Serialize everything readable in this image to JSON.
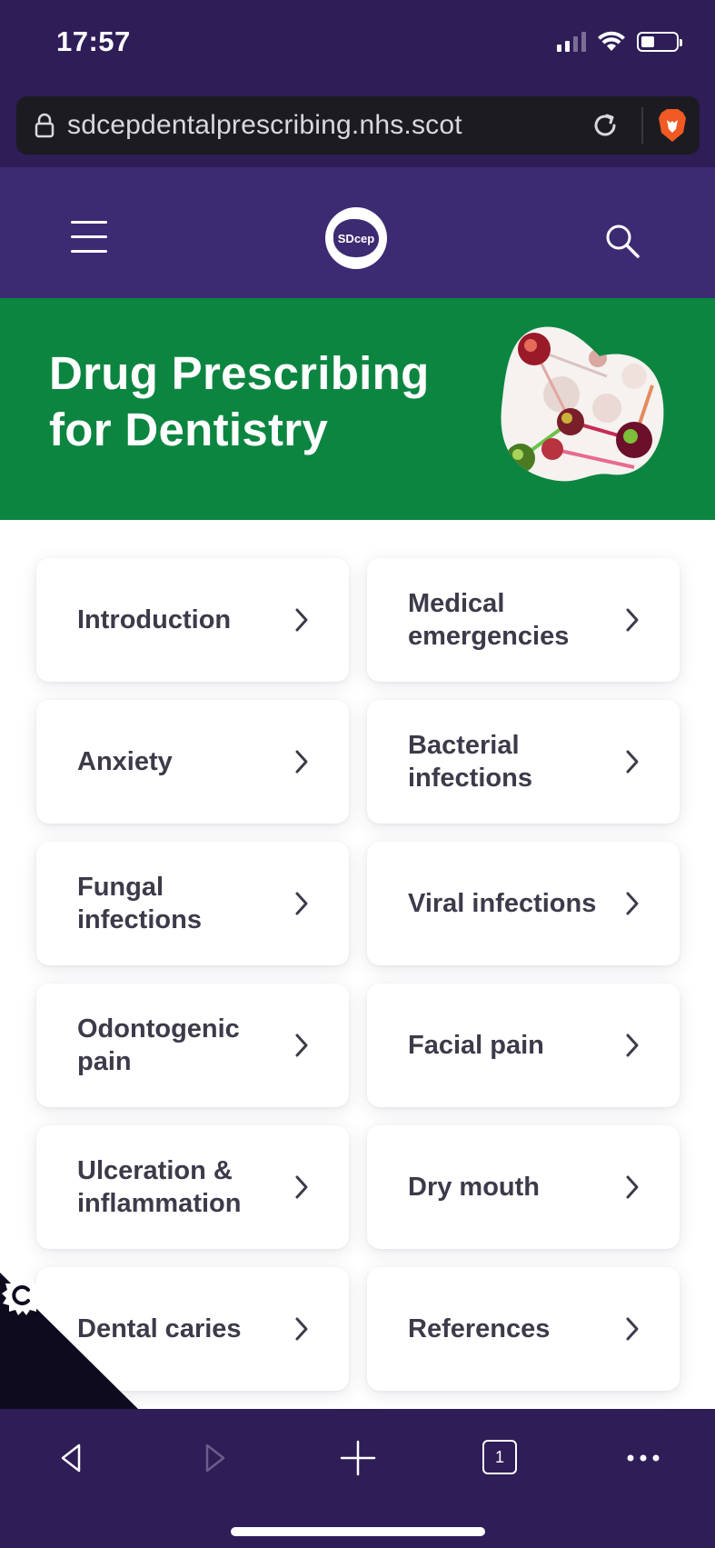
{
  "status_bar": {
    "time": "17:57"
  },
  "browser": {
    "url": "sdcepdentalprescribing.nhs.scot"
  },
  "site": {
    "logo_text": "SDcep"
  },
  "hero": {
    "title_line1": "Drug Prescribing",
    "title_line2": "for Dentistry"
  },
  "topics": [
    {
      "label": "Introduction"
    },
    {
      "label": "Medical emergencies"
    },
    {
      "label": "Anxiety"
    },
    {
      "label": "Bacterial infections"
    },
    {
      "label": "Fungal infections"
    },
    {
      "label": "Viral infections"
    },
    {
      "label": "Odontogenic pain"
    },
    {
      "label": "Facial pain"
    },
    {
      "label": "Ulceration & inflammation"
    },
    {
      "label": "Dry mouth"
    },
    {
      "label": "Dental caries"
    },
    {
      "label": "References"
    }
  ],
  "tabs": {
    "count": "1"
  },
  "colors": {
    "brand_purple": "#3c2a72",
    "hero_green": "#0c8540",
    "text_dark": "#3b3b4a"
  },
  "icons": [
    "lock-icon",
    "reload-icon",
    "brave-lion-icon",
    "hamburger-icon",
    "search-icon",
    "chevron-right-icon",
    "cookie-settings-icon",
    "back-icon",
    "forward-icon",
    "new-tab-icon",
    "tabs-icon",
    "more-icon"
  ]
}
